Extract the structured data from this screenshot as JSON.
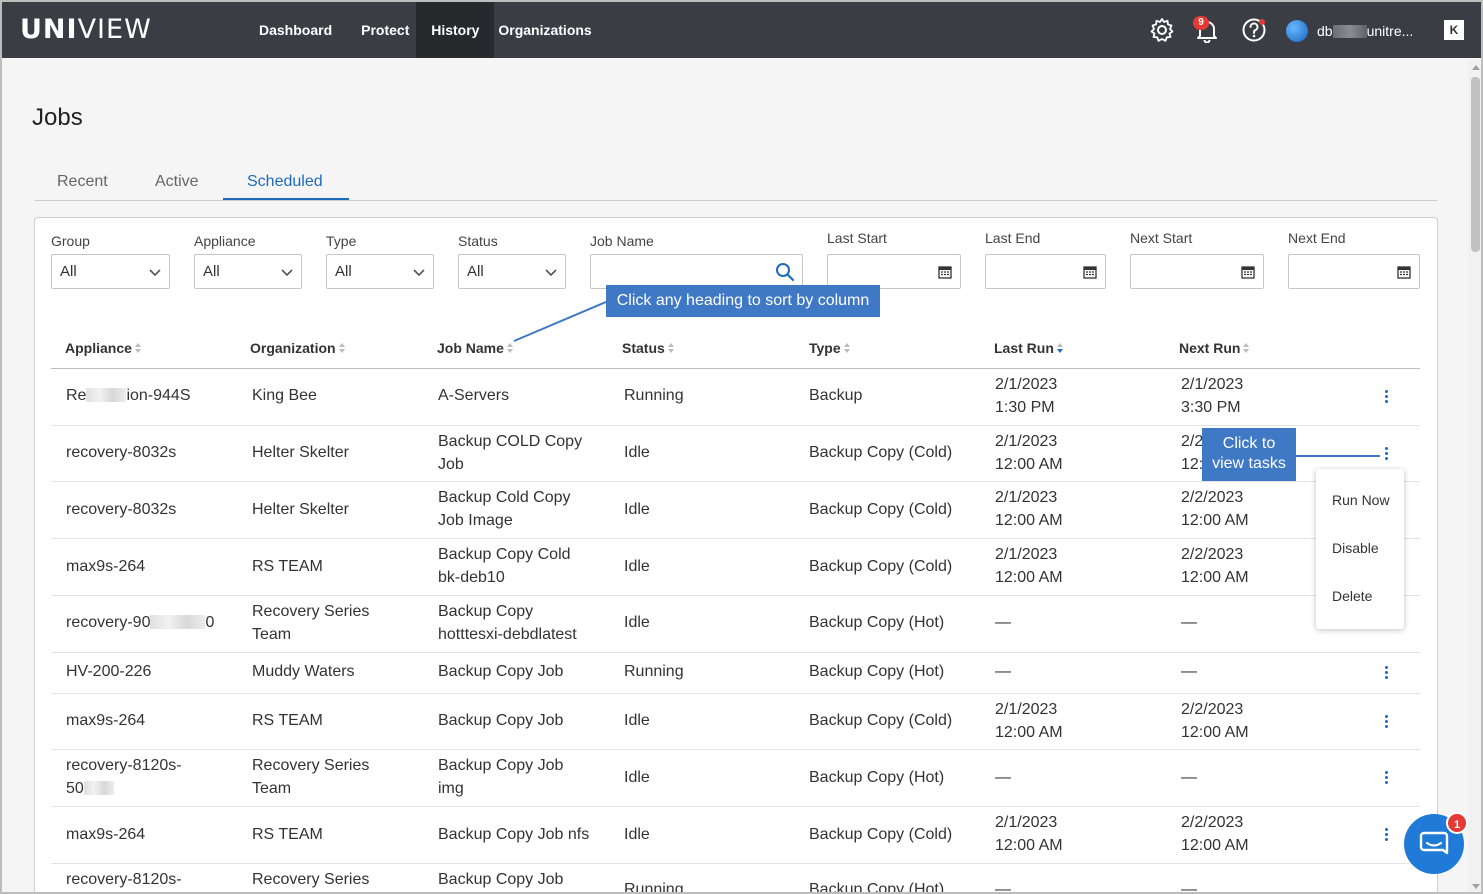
{
  "brand": {
    "logo_bold": "UNI",
    "logo_light": "VIEW"
  },
  "nav": {
    "items": [
      {
        "label": "Dashboard"
      },
      {
        "label": "Protect"
      },
      {
        "label": "History",
        "active": true
      },
      {
        "label": "Organizations"
      }
    ]
  },
  "topbar": {
    "notification_count": "9",
    "user_name_prefix": "db",
    "user_name_suffix": "unitre...",
    "logout_glyph": "K"
  },
  "page": {
    "title": "Jobs"
  },
  "tabs": [
    {
      "label": "Recent"
    },
    {
      "label": "Active"
    },
    {
      "label": "Scheduled",
      "active": true
    }
  ],
  "filters": {
    "group": {
      "label": "Group",
      "value": "All"
    },
    "appliance": {
      "label": "Appliance",
      "value": "All"
    },
    "type": {
      "label": "Type",
      "value": "All"
    },
    "status": {
      "label": "Status",
      "value": "All"
    },
    "job_name": {
      "label": "Job Name",
      "value": ""
    },
    "last_start": {
      "label": "Last Start",
      "value": ""
    },
    "last_end": {
      "label": "Last End",
      "value": ""
    },
    "next_start": {
      "label": "Next Start",
      "value": ""
    },
    "next_end": {
      "label": "Next End",
      "value": ""
    }
  },
  "table": {
    "columns": [
      "Appliance",
      "Organization",
      "Job Name",
      "Status",
      "Type",
      "Last Run",
      "Next Run"
    ],
    "sorted_column": "Last Run",
    "rows": [
      {
        "appliance_a": "Re",
        "appliance_b": "ion-944S",
        "organization": [
          "King Bee"
        ],
        "job_name": [
          "A-Servers"
        ],
        "status": "Running",
        "type": "Backup",
        "last_run": [
          "2/1/2023",
          "1:30 PM"
        ],
        "next_run": [
          "2/1/2023",
          "3:30 PM"
        ]
      },
      {
        "appliance": [
          "recovery-8032s"
        ],
        "organization": [
          "Helter Skelter"
        ],
        "job_name": [
          "Backup COLD Copy",
          "Job"
        ],
        "status": "Idle",
        "type": "Backup Copy (Cold)",
        "last_run": [
          "2/1/2023",
          "12:00 AM"
        ],
        "next_run": [
          "2/2",
          "12:"
        ]
      },
      {
        "appliance": [
          "recovery-8032s"
        ],
        "organization": [
          "Helter Skelter"
        ],
        "job_name": [
          "Backup Cold Copy",
          "Job Image"
        ],
        "status": "Idle",
        "type": "Backup Copy (Cold)",
        "last_run": [
          "2/1/2023",
          "12:00 AM"
        ],
        "next_run": [
          "2/2/2023",
          "12:00 AM"
        ]
      },
      {
        "appliance": [
          "max9s-264"
        ],
        "organization": [
          "RS TEAM"
        ],
        "job_name": [
          "Backup Copy Cold",
          "bk-deb10"
        ],
        "status": "Idle",
        "type": "Backup Copy (Cold)",
        "last_run": [
          "2/1/2023",
          "12:00 AM"
        ],
        "next_run": [
          "2/2/2023",
          "12:00 AM"
        ]
      },
      {
        "appliance_a": "recovery-90",
        "appliance_b": "0",
        "organization": [
          "Recovery Series",
          "Team"
        ],
        "job_name": [
          "Backup Copy",
          "hotttesxi-debdlatest"
        ],
        "status": "Idle",
        "type": "Backup Copy (Hot)",
        "last_run": [
          "—"
        ],
        "next_run": [
          "—"
        ]
      },
      {
        "appliance": [
          "HV-200-226"
        ],
        "organization": [
          "Muddy Waters"
        ],
        "job_name": [
          "Backup Copy Job"
        ],
        "status": "Running",
        "type": "Backup Copy (Hot)",
        "last_run": [
          "—"
        ],
        "next_run": [
          "—"
        ]
      },
      {
        "appliance": [
          "max9s-264"
        ],
        "organization": [
          "RS TEAM"
        ],
        "job_name": [
          "Backup Copy Job"
        ],
        "status": "Idle",
        "type": "Backup Copy (Cold)",
        "last_run": [
          "2/1/2023",
          "12:00 AM"
        ],
        "next_run": [
          "2/2/2023",
          "12:00 AM"
        ]
      },
      {
        "appliance": [
          "recovery-8120s-",
          "50"
        ],
        "organization": [
          "Recovery Series",
          "Team"
        ],
        "job_name": [
          "Backup Copy Job",
          "img"
        ],
        "status": "Idle",
        "type": "Backup Copy (Hot)",
        "last_run": [
          "—"
        ],
        "next_run": [
          "—"
        ]
      },
      {
        "appliance": [
          "max9s-264"
        ],
        "organization": [
          "RS TEAM"
        ],
        "job_name": [
          "Backup Copy Job nfs"
        ],
        "status": "Idle",
        "type": "Backup Copy (Cold)",
        "last_run": [
          "2/1/2023",
          "12:00 AM"
        ],
        "next_run": [
          "2/2/2023",
          "12:00 AM"
        ]
      },
      {
        "appliance": [
          "recovery-8120s-"
        ],
        "organization": [
          "Recovery Series"
        ],
        "job_name": [
          "Backup Copy Job"
        ],
        "status": "Running",
        "type": "Backup Copy (Hot)",
        "last_run": [
          "—"
        ],
        "next_run": [
          "—"
        ]
      }
    ]
  },
  "callouts": {
    "sort_hint": "Click any heading to sort by column",
    "tasks_hint_line1": "Click to",
    "tasks_hint_line2": "view tasks"
  },
  "context_menu": {
    "items": [
      {
        "label": "Run Now"
      },
      {
        "label": "Disable"
      },
      {
        "label": "Delete"
      }
    ]
  },
  "chat": {
    "unread_count": "1"
  },
  "colors": {
    "topbar": "#3a3e44",
    "accent": "#1e6bbd",
    "callout": "#3f78c4",
    "badge": "#e53935",
    "chat": "#1f7ad8"
  }
}
